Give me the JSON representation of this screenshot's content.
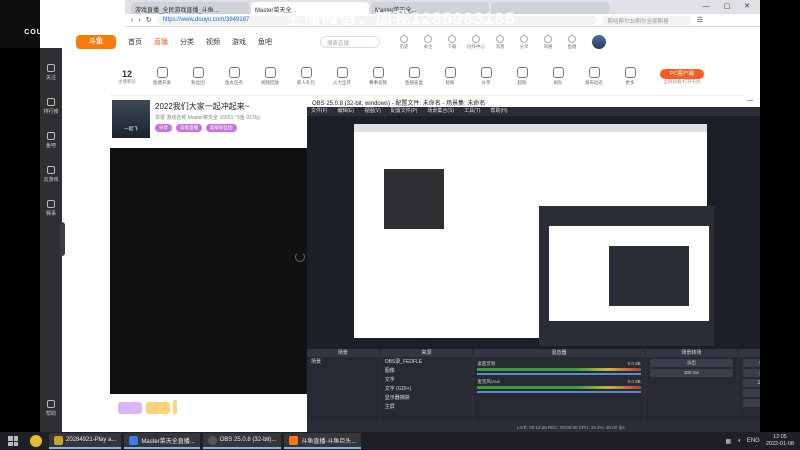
{
  "overlay": {
    "game_logo": "COUNTER-STRIKE",
    "watermark": "主播微信：加我1285983185"
  },
  "browser": {
    "tabs": [
      "游戏直播_全民游戏直播_斗鱼...",
      "Master菜天全...",
      "Master菜天全...",
      ""
    ],
    "url": "https://www.douyu.com/3949187",
    "search_placeholder": "斯哈斯尔30斯尔全部斯格"
  },
  "sidebar": {
    "items": [
      "关注",
      "排行榜",
      "鱼吧",
      "云游戏",
      "赛事",
      "帮助"
    ]
  },
  "nav": {
    "logo": "斗鱼",
    "links": [
      "首页",
      "直播",
      "分类",
      "视频",
      "游戏",
      "鱼吧"
    ],
    "active_link": "直播",
    "search_placeholder": "搜索直播",
    "topics": [
      "历史",
      "关注",
      "下载",
      "创作中心",
      "消息",
      "分享",
      "风格",
      "鱼塘"
    ]
  },
  "giftbar": {
    "level_num": "12",
    "level_label": "主播积分",
    "gifts": [
      "鱼塘开发",
      "粉丝团",
      "鱼丸任务",
      "视频回放",
      "新人礼包",
      "火力全开",
      "赛事竞猜",
      "鱼翅盲盒",
      "钻粉",
      "分享",
      "超粉",
      "组队",
      "发布动态",
      "更多"
    ],
    "pc_label": "PC客户端",
    "pc_sub": "全屏观看/打开方式"
  },
  "room": {
    "title": "2022我们大家一起冲起来~",
    "tag_line": "举报  游戏名称   Master菜天全  16551  飞鱼  937kg",
    "thumb_label": "一起飞",
    "buttons": [
      "分享",
      "高能直播",
      "超级粉丝团"
    ]
  },
  "obs": {
    "title": "OBS 25.0.8 (32-bit, windows) - 配置文件: 未命名 - 场景集: 未命名",
    "menu": [
      "文件(F)",
      "编辑(E)",
      "视图(V)",
      "配置文件(P)",
      "场景集合(S)",
      "工具(T)",
      "帮助(H)"
    ],
    "docks": {
      "scenes": "场景",
      "sources": "来源",
      "mixer": "混音器",
      "transitions": "场景转场",
      "controls": "控件"
    },
    "scenes_list": [
      "场景"
    ],
    "sources_list": [
      "OBS录_FEDFLE",
      "图像",
      "文字",
      "文字 (GDI+)",
      "显示器捕获",
      "主屏"
    ],
    "mixer": [
      {
        "name": "桌面音频",
        "db": "0.0 dB"
      },
      {
        "name": "麦克风/Aux",
        "db": "0.0 dB"
      }
    ],
    "transition": "淡出",
    "duration": "300 ms",
    "controls": [
      "停止直播",
      "开始录制",
      "工作室模式",
      "设置",
      "退出"
    ],
    "status": "LIVE: 00:12:45  REC: 00:00:00  CPU: 15.3%, 30.00 fps"
  },
  "taskbar": {
    "items": [
      "20284921-Play a...",
      "Master菜天全直播...",
      "OBS 25.0.8 (32-bit)...",
      "斗鱼直播-斗鱼巨头..."
    ],
    "tray": "ENG",
    "time": "12:05",
    "date": "2022-01-08"
  }
}
